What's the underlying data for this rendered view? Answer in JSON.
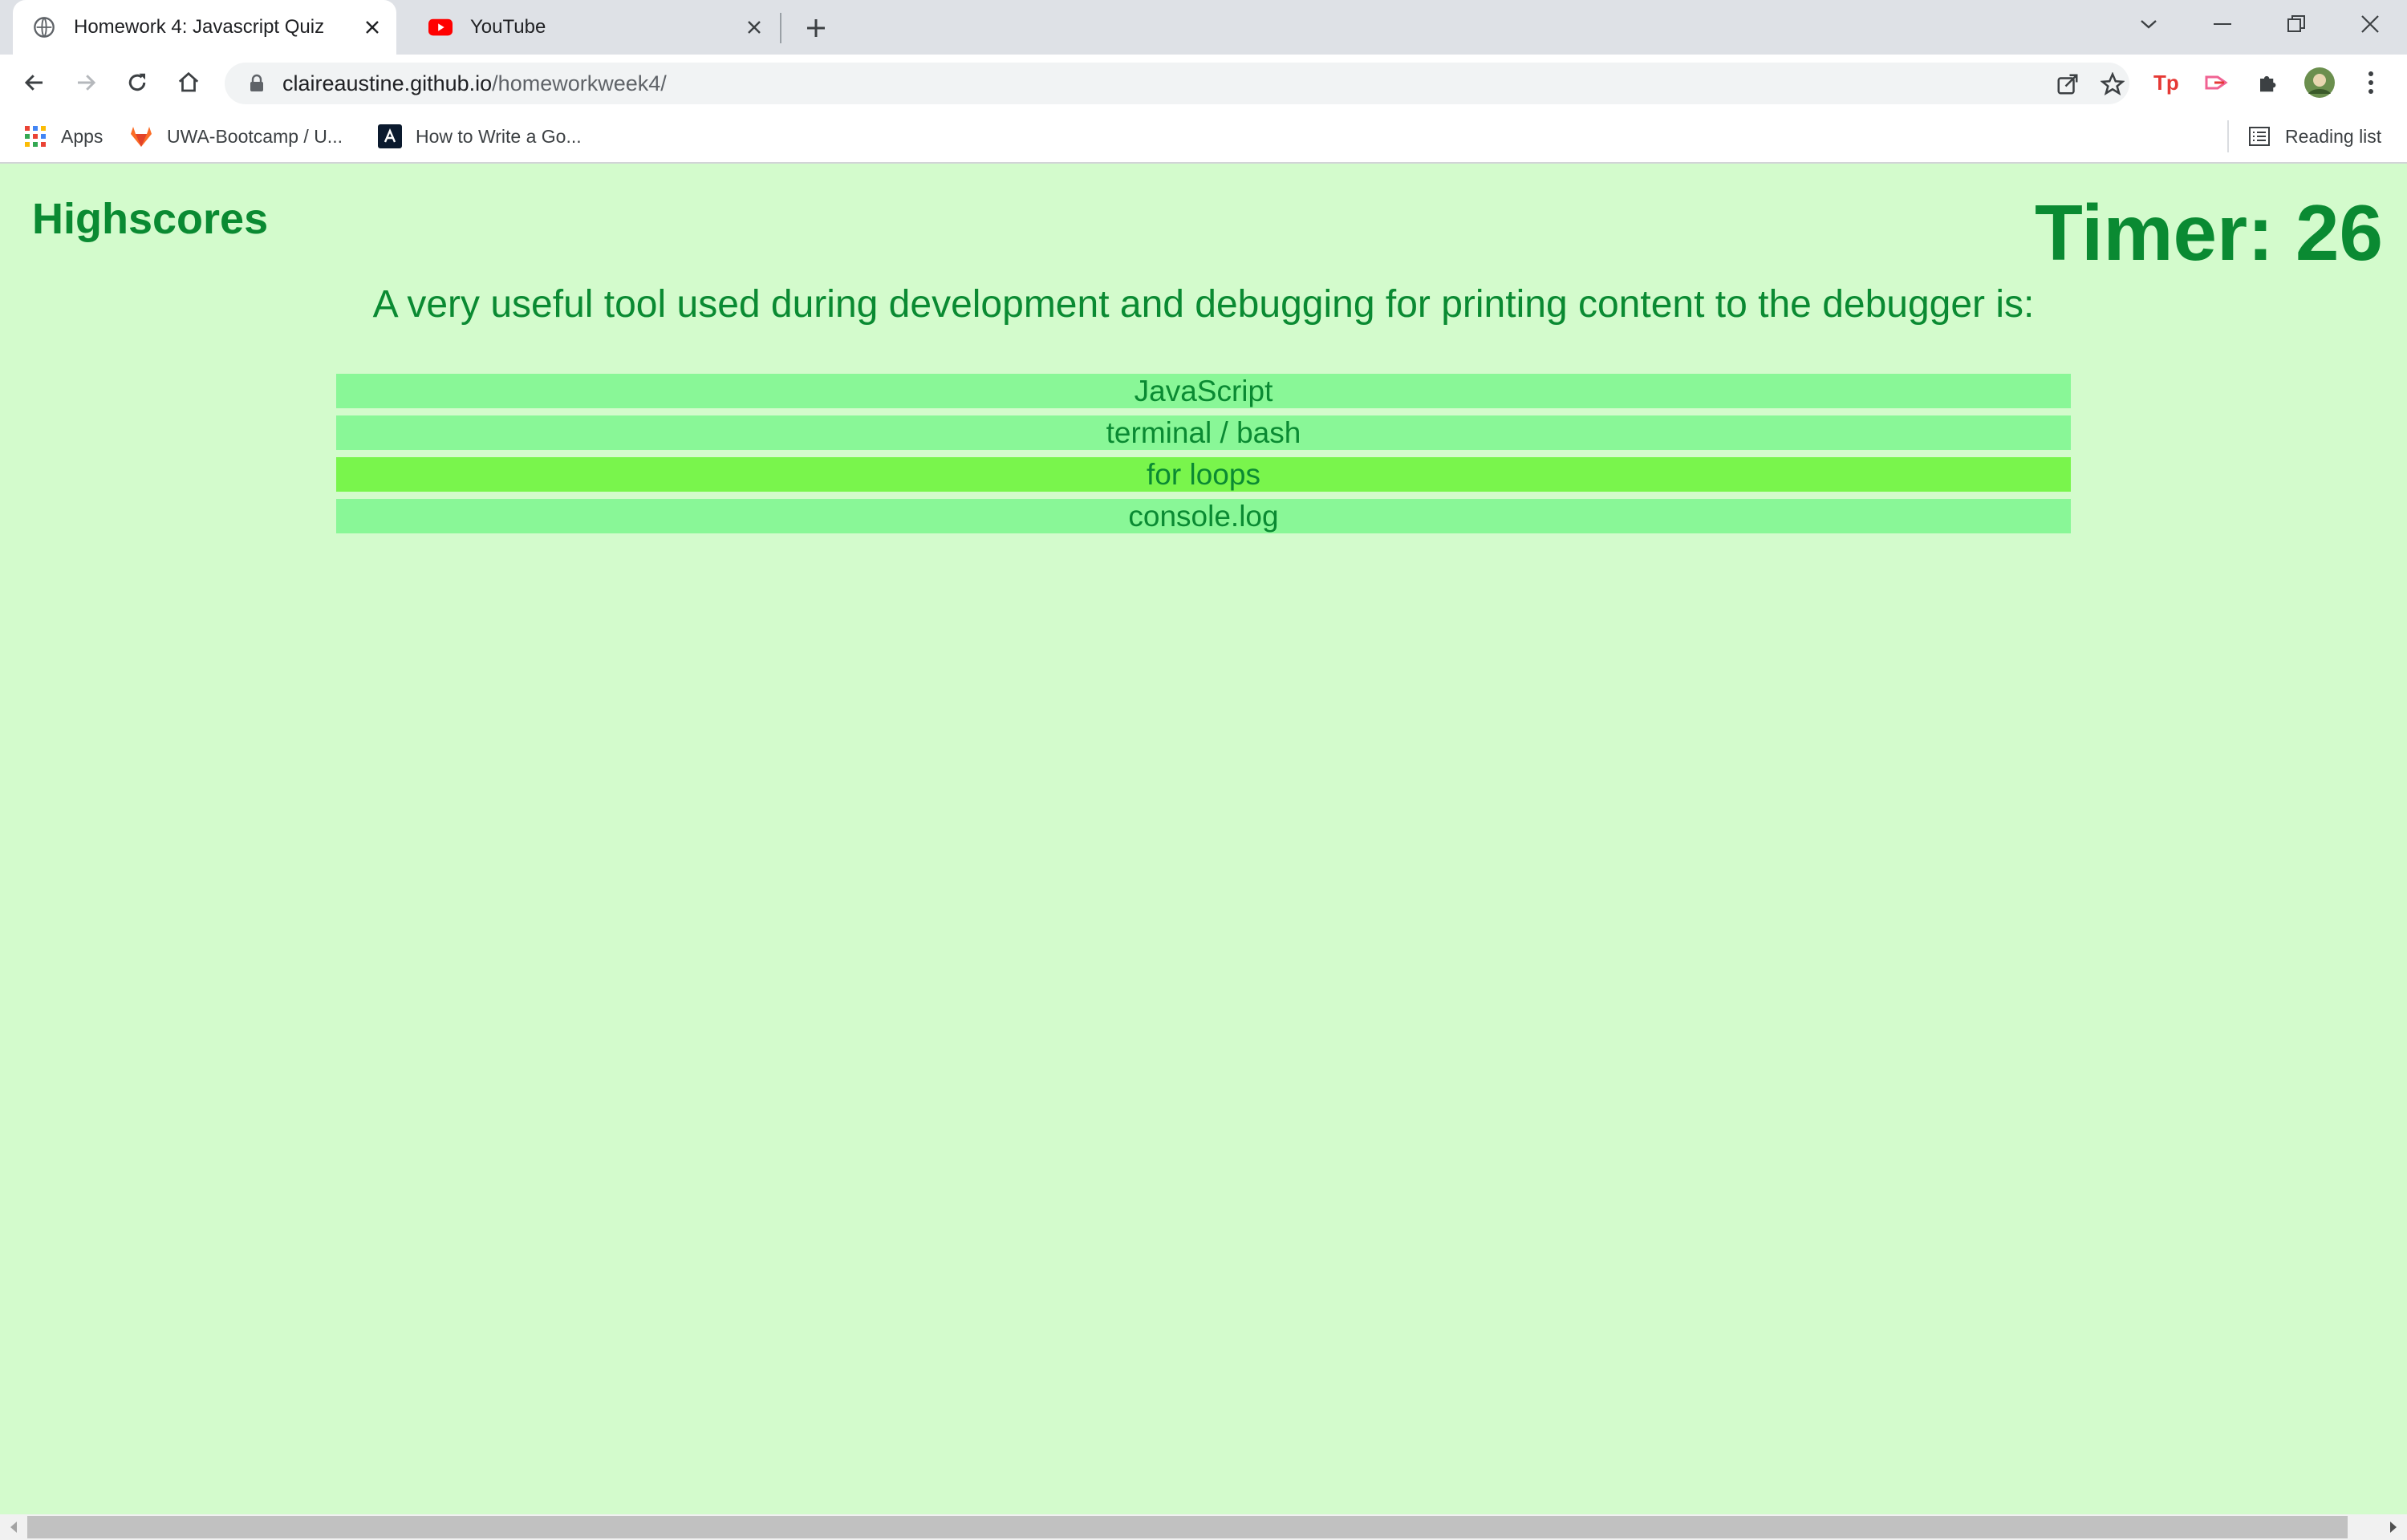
{
  "browser": {
    "tabs": [
      {
        "title": "Homework 4: Javascript Quiz",
        "active": true,
        "icon": "globe-icon"
      },
      {
        "title": "YouTube",
        "active": false,
        "icon": "youtube-icon"
      }
    ],
    "url_host": "claireaustine.github.io",
    "url_path": "/homeworkweek4/",
    "bookmarks": [
      {
        "label": "Apps",
        "icon": "apps-grid-icon"
      },
      {
        "label": "UWA-Bootcamp / U...",
        "icon": "gitlab-icon"
      },
      {
        "label": "How to Write a Go...",
        "icon": "article-icon"
      }
    ],
    "reading_list": "Reading list"
  },
  "quiz": {
    "highscores_label": "Highscores",
    "timer_text": "Timer: 26",
    "question": "A very useful tool used during development and debugging for printing content to the debugger is:",
    "answers": [
      "JavaScript",
      "terminal / bash",
      "for loops",
      "console.log"
    ],
    "highlighted_answer": "for loops"
  },
  "colors": {
    "page_bg": "#d3fbcc",
    "text_green": "#0a8a32",
    "answer_bg": "#89f797",
    "answer_hover_bg": "#79f54c"
  }
}
